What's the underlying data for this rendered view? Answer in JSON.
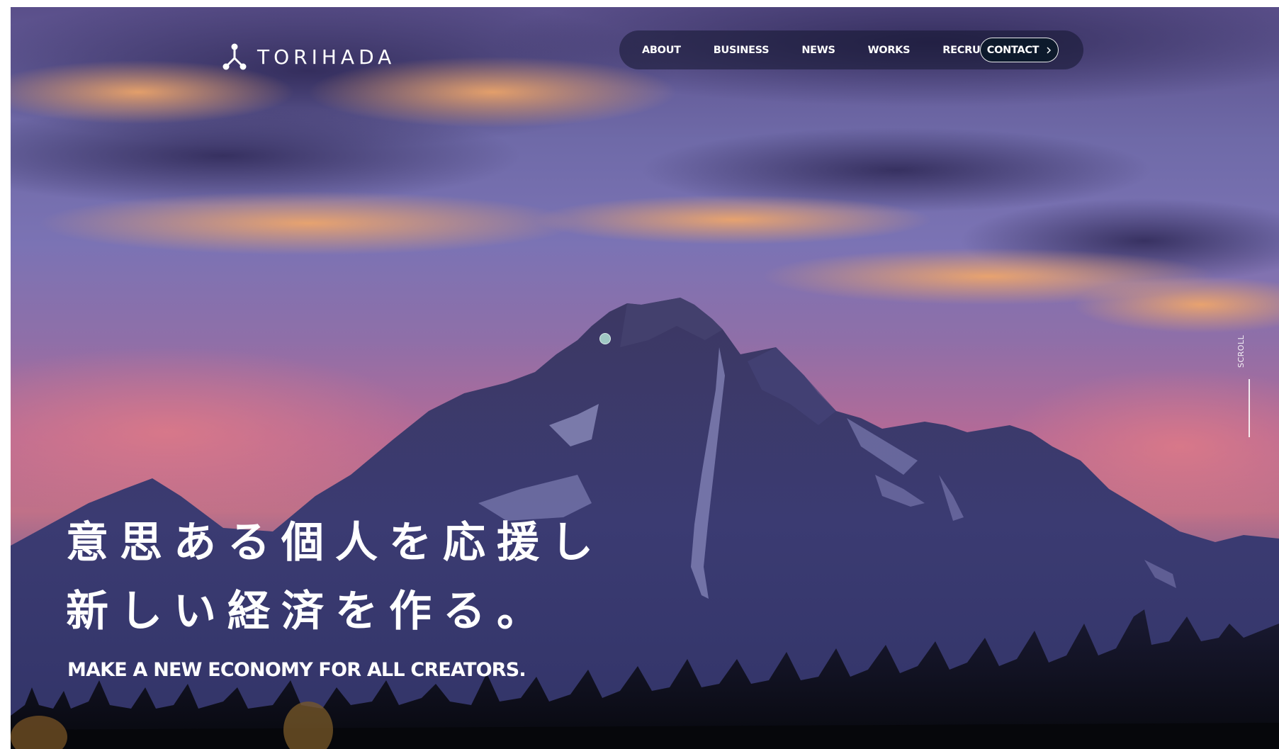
{
  "brand": {
    "name": "TORIHADA",
    "logo_icon": "molecule-node-icon"
  },
  "nav": {
    "items": [
      {
        "label": "ABOUT"
      },
      {
        "label": "BUSINESS"
      },
      {
        "label": "NEWS"
      },
      {
        "label": "WORKS"
      },
      {
        "label": "RECRUIT"
      }
    ],
    "contact": {
      "label": "CONTACT",
      "icon": "chevron-right-icon"
    }
  },
  "hero": {
    "headline_line1": "意思ある個人を応援し",
    "headline_line2": "新しい経済を作る。",
    "subline": "MAKE A NEW ECONOMY FOR ALL CREATORS.",
    "background": "mountain-sunset-photo"
  },
  "scroll": {
    "label": "SCROLL"
  },
  "colors": {
    "text": "#ffffff",
    "nav_pill": "#1a1b36",
    "contact_bg": "#0d1a2c",
    "sky_top": "#3e3b7c",
    "sky_glow": "#e88a55",
    "mountain": "#3a3a6e",
    "forest": "#0b0d14"
  }
}
